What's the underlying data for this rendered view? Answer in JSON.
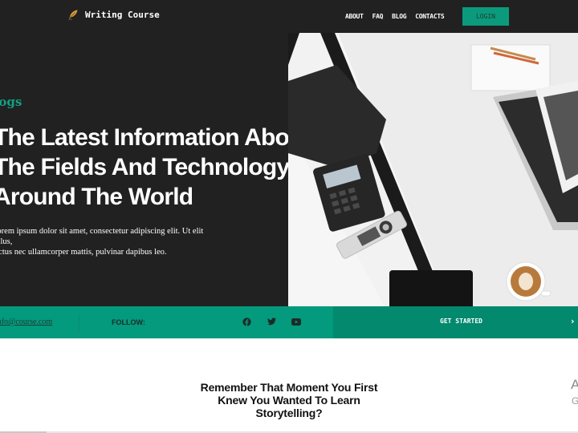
{
  "brand": {
    "name": "Writing Course",
    "logo_icon": "feather-quill-icon"
  },
  "nav": {
    "items": [
      {
        "label": "ABOUT"
      },
      {
        "label": "FAQ"
      },
      {
        "label": "BLOG"
      },
      {
        "label": "CONTACTS"
      }
    ],
    "login_label": "LOGIN"
  },
  "hero": {
    "eyebrow": "Blogs",
    "headline_lines": [
      "The Latest Information About",
      "The Fields And Technology",
      "Around The World"
    ],
    "description_lines": [
      "Lorem ipsum dolor sit amet, consectetur adipiscing elit. Ut elit tellus,",
      "luctus nec ullamcorper mattis, pulvinar dapibus leo."
    ],
    "image_alt": "Desk with laptop, conference phone, remote, tablet, notepad and coffee"
  },
  "band": {
    "email": "info@course.com",
    "follow_label": "FOLLOW:",
    "social": [
      {
        "icon": "facebook-icon"
      },
      {
        "icon": "twitter-icon"
      },
      {
        "icon": "youtube-icon"
      }
    ],
    "cta_label": "GET STARTED",
    "cta_icon": "chevron-right-icon"
  },
  "section": {
    "question_lines": [
      "Remember That Moment You First",
      "Knew You Wanted To Learn",
      "Storytelling?"
    ],
    "peek_heading": "A",
    "peek_sub": "G"
  },
  "colors": {
    "dark_bg": "#212121",
    "accent": "#039a7d",
    "accent_dark": "#02896e",
    "eyebrow": "#12a185"
  }
}
